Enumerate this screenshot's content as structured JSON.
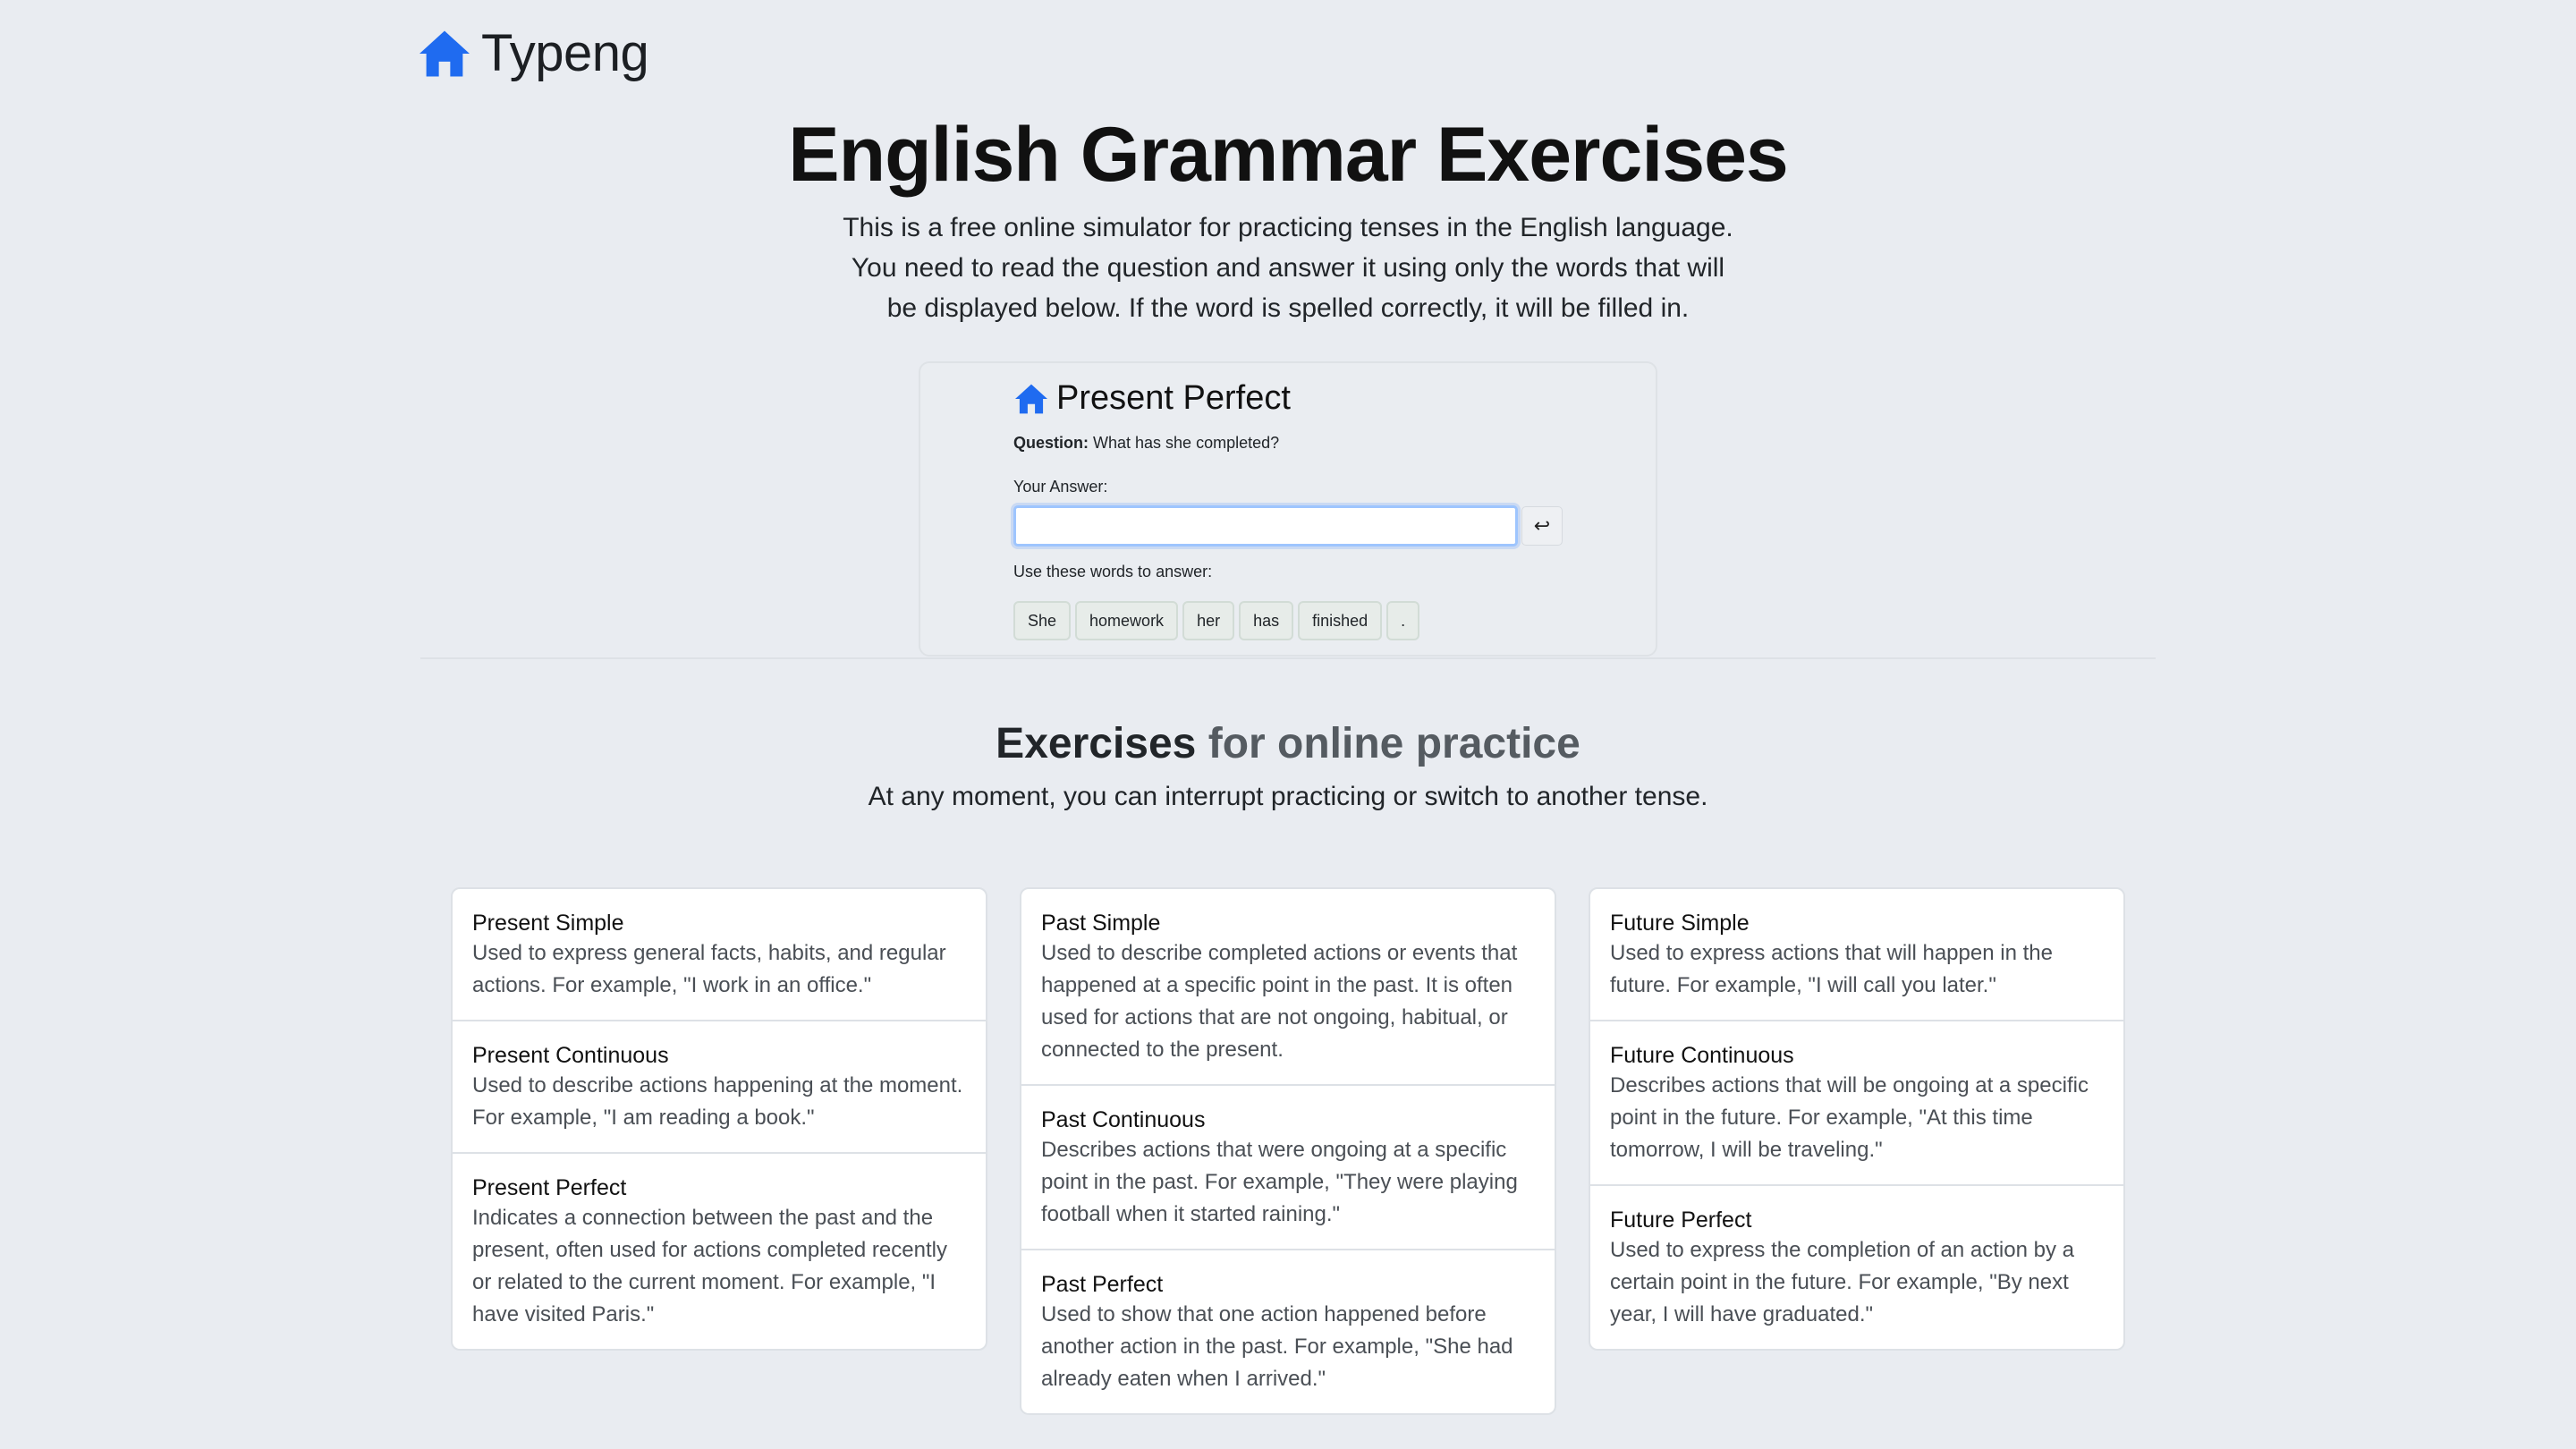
{
  "header": {
    "logo_text": "Typeng",
    "logo_icon": "house-icon"
  },
  "hero": {
    "title": "English Grammar Exercises",
    "description_lines": [
      "This is a free online simulator for practicing tenses in the English language.",
      "You need to read the question and answer it using only the words that will",
      "be displayed below. If the word is spelled correctly, it will be filled in."
    ]
  },
  "demo": {
    "title": "Present Perfect",
    "question_label": "Question:",
    "question": "What has she completed?",
    "answer_label": "Your Answer:",
    "answer_value": "",
    "enter_symbol": "↩",
    "words_label": "Use these words to answer:",
    "words": [
      "She",
      "homework",
      "her",
      "has",
      "finished",
      "."
    ]
  },
  "exercises": {
    "title_main": "Exercises",
    "title_muted": "for online practice",
    "subtitle": "At any moment, you can interrupt practicing or switch to another tense.",
    "columns": [
      [
        {
          "title": "Present Simple",
          "desc": "Used to express general facts, habits, and regular actions. For example, \"I work in an office.\""
        },
        {
          "title": "Present Continuous",
          "desc": "Used to describe actions happening at the moment. For example, \"I am reading a book.\""
        },
        {
          "title": "Present Perfect",
          "desc": "Indicates a connection between the past and the present, often used for actions completed recently or related to the current moment. For example, \"I have visited Paris.\""
        }
      ],
      [
        {
          "title": "Past Simple",
          "desc": "Used to describe completed actions or events that happened at a specific point in the past. It is often used for actions that are not ongoing, habitual, or connected to the present."
        },
        {
          "title": "Past Continuous",
          "desc": "Describes actions that were ongoing at a specific point in the past. For example, \"They were playing football when it started raining.\""
        },
        {
          "title": "Past Perfect",
          "desc": "Used to show that one action happened before another action in the past. For example, \"She had already eaten when I arrived.\""
        }
      ],
      [
        {
          "title": "Future Simple",
          "desc": "Used to express actions that will happen in the future. For example, \"I will call you later.\""
        },
        {
          "title": "Future Continuous",
          "desc": "Describes actions that will be ongoing at a specific point in the future. For example, \"At this time tomorrow, I will be traveling.\""
        },
        {
          "title": "Future Perfect",
          "desc": "Used to express the completion of an action by a certain point in the future. For example, \"By next year, I will have graduated.\""
        }
      ]
    ]
  },
  "colors": {
    "accent": "#1f6bf0",
    "background": "#e9ecf1"
  }
}
